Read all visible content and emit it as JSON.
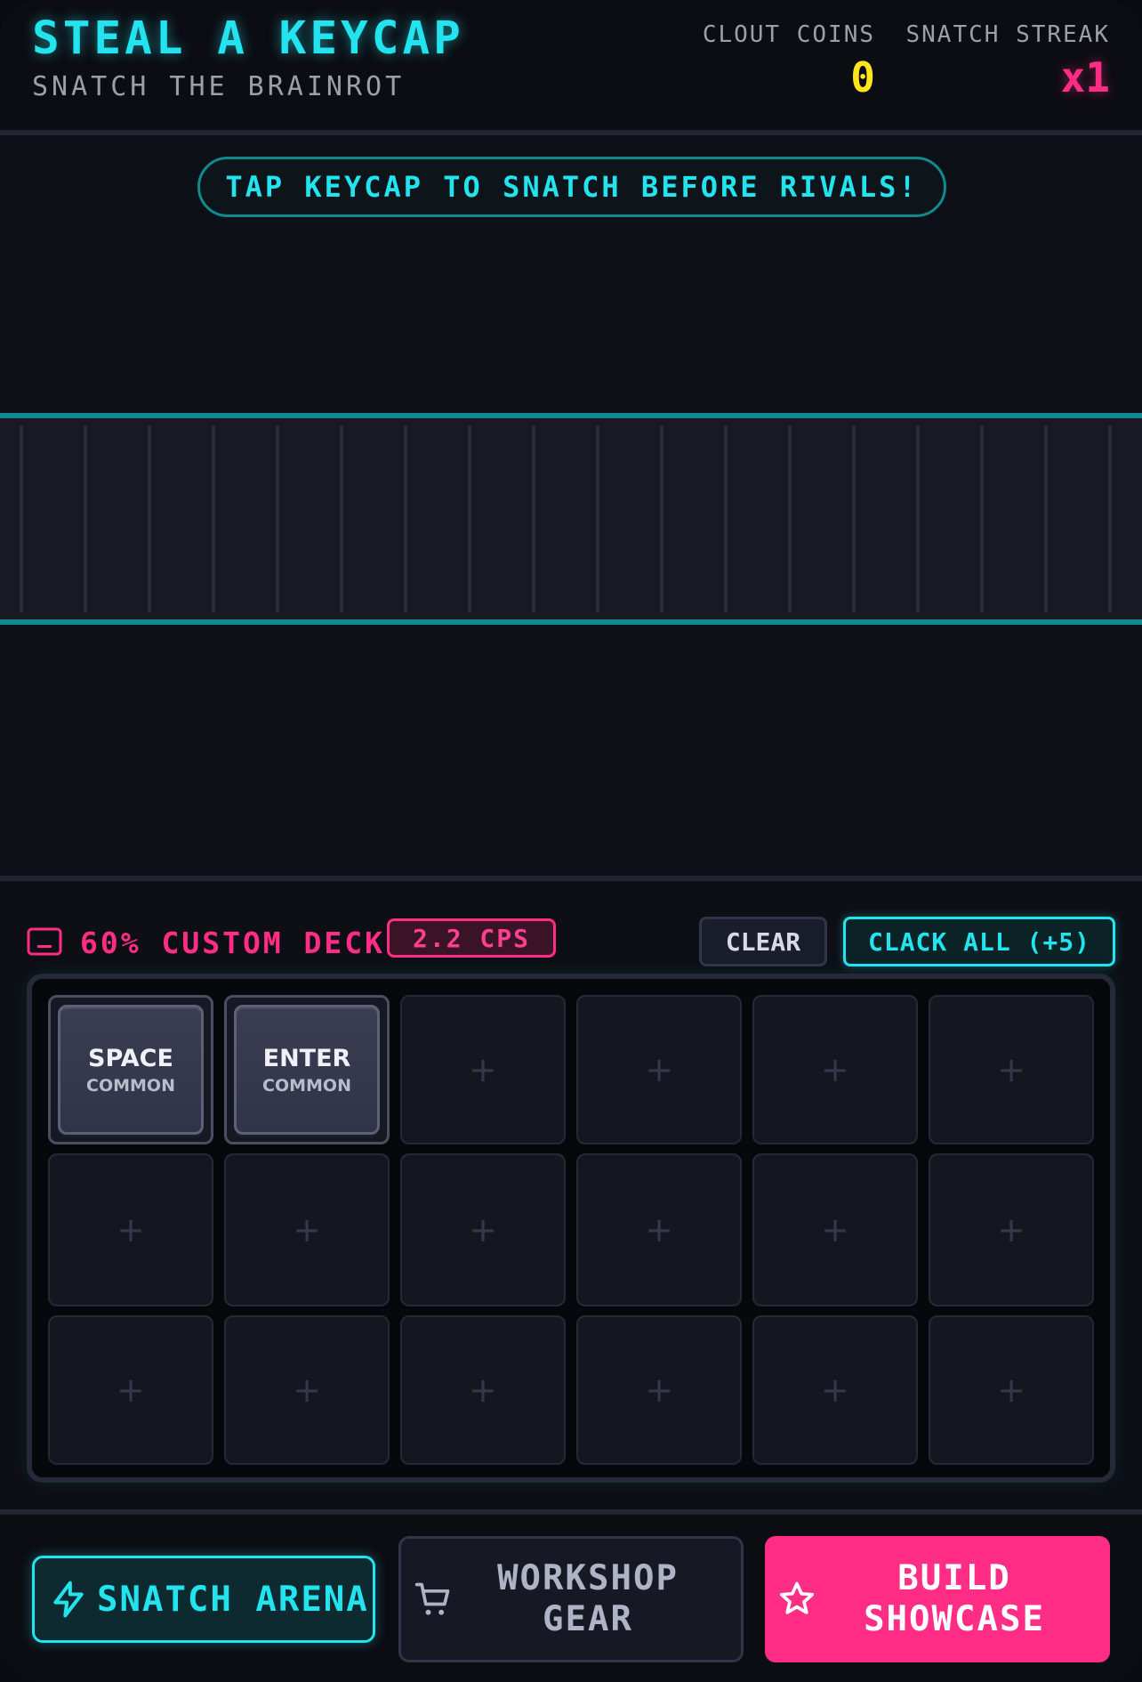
{
  "header": {
    "title": "STEAL A KEYCAP",
    "subtitle": "SNATCH THE BRAINROT",
    "coins_label": "CLOUT COINS",
    "coins_value": "0",
    "streak_label": "SNATCH STREAK",
    "streak_value": "x1"
  },
  "arena": {
    "banner": "TAP KEYCAP TO SNATCH BEFORE RIVALS!"
  },
  "deck": {
    "label": "60% CUSTOM DECK",
    "cps": "2.2 CPS",
    "clear_label": "CLEAR",
    "clack_label": "CLACK ALL (+5)",
    "empty_symbol": "+",
    "keys": [
      {
        "name": "SPACE",
        "rarity": "COMMON"
      },
      {
        "name": "ENTER",
        "rarity": "COMMON"
      }
    ]
  },
  "nav": {
    "arena_label": "SNATCH ARENA",
    "gear_label": "WORKSHOP GEAR",
    "showcase_label": "BUILD SHOWCASE"
  },
  "colors": {
    "accent_cyan": "#22e3ee",
    "accent_pink": "#ff2d86",
    "coin_yellow": "#ffe51a"
  },
  "icons": [
    "keyboard-icon",
    "lightning-icon",
    "cart-icon",
    "star-icon"
  ]
}
